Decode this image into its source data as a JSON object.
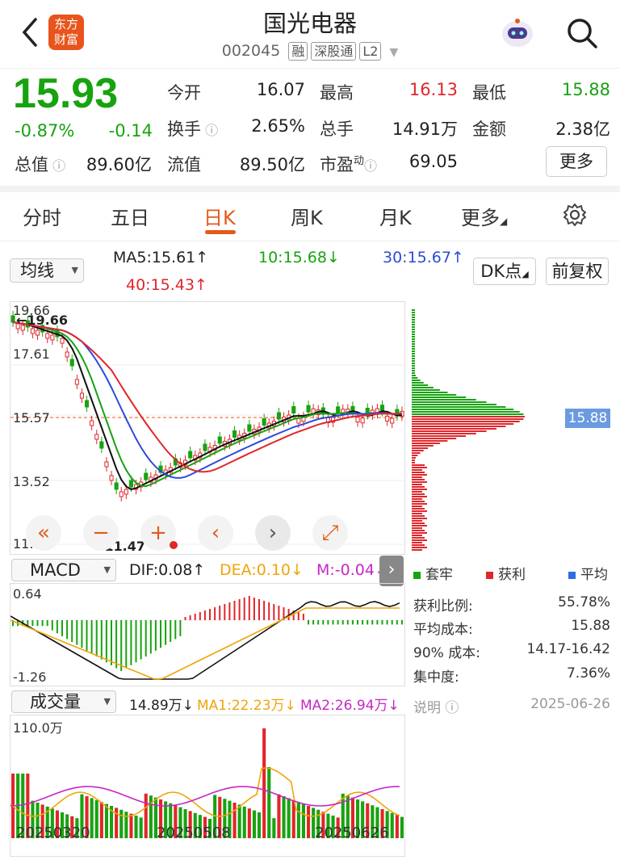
{
  "header": {
    "back_icon": "chevron-left-icon",
    "logo_text": "东方财富",
    "title": "国光电器",
    "code": "002045",
    "tags": [
      "融",
      "深股通",
      "L2"
    ],
    "robot_icon": "robot-avatar-icon",
    "search_icon": "search-icon"
  },
  "quote": {
    "price": "15.93",
    "change_pct": "-0.87%",
    "change": "-0.14",
    "open_label": "今开",
    "open": "16.07",
    "high_label": "最高",
    "high": "16.13",
    "low_label": "最低",
    "low": "15.88",
    "turnover_label": "换手",
    "turnover": "2.65%",
    "volume_label": "总手",
    "volume": "14.91万",
    "amount_label": "金额",
    "amount": "2.38亿",
    "mktcap_label": "总值",
    "mktcap": "89.60亿",
    "float_label": "流值",
    "float_cap": "89.50亿",
    "pe_label": "市盈",
    "pe_sup": "动",
    "pe": "69.05",
    "more_label": "更多"
  },
  "tabs": [
    "分时",
    "五日",
    "日K",
    "周K",
    "月K",
    "更多"
  ],
  "active_tab": "日K",
  "indicator": {
    "selector": "均线",
    "ma5": "MA5:15.61↑",
    "ma10": "10:15.68↓",
    "ma30": "30:15.67↑",
    "ma40": "40:15.43↑",
    "dk_label": "DK点",
    "adjust_label": "前复权"
  },
  "kline": {
    "y_labels": [
      "19.66",
      "17.61",
      "15.57",
      "13.52",
      "11.47"
    ],
    "max_mark": "19.66",
    "min_mark": "11.47",
    "current_price_tag": "15.88"
  },
  "controls": [
    "«",
    "−",
    "+",
    "‹",
    "›",
    "⤢"
  ],
  "macd": {
    "selector": "MACD",
    "dif": "DIF:0.08↑",
    "dea": "DEA:0.10↓",
    "m": "M:-0.04↓",
    "y_top": "0.64",
    "y_bottom": "-1.26"
  },
  "volume": {
    "selector": "成交量",
    "value": "14.89万↓",
    "ma1": "MA1:22.23万↓",
    "ma2": "MA2:26.94万↓",
    "y_top": "110.0万",
    "dates": [
      "20250320",
      "20250508",
      "20250626"
    ]
  },
  "chip": {
    "legend": [
      "套牢",
      "获利",
      "平均"
    ],
    "stats": [
      {
        "label": "获利比例:",
        "value": "55.78%"
      },
      {
        "label": "平均成本:",
        "value": "15.88"
      },
      {
        "label": "90% 成本:",
        "value": "14.17-16.42"
      },
      {
        "label": "集中度:",
        "value": "7.36%"
      }
    ],
    "note": "说明",
    "date": "2025-06-26"
  },
  "colors": {
    "up": "#e0262b",
    "down": "#17a30f",
    "accent": "#e35a1a",
    "ma_blue": "#2d4bd6"
  }
}
